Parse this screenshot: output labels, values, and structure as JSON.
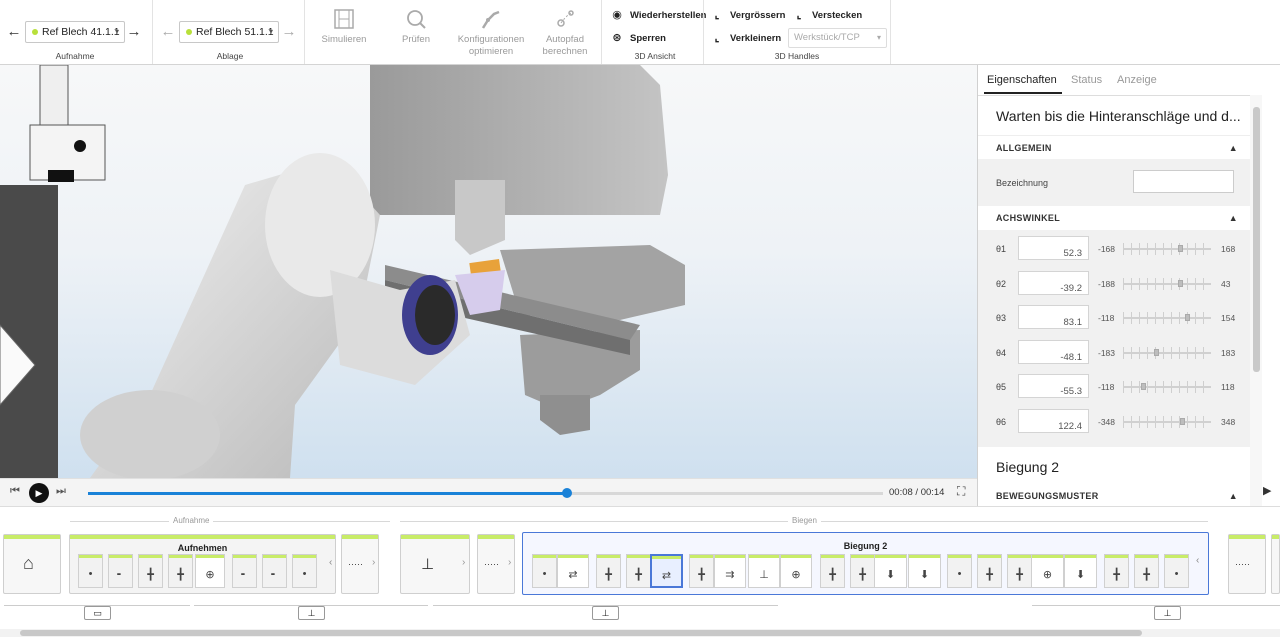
{
  "toolbar": {
    "aufnahme": {
      "value": "Ref Blech 41.1.1",
      "label": "Aufnahme"
    },
    "ablage": {
      "value": "Ref Blech 51.1.1",
      "label": "Ablage"
    },
    "simulieren": "Simulieren",
    "pruefen": "Prüfen",
    "konfig_1": "Konfigurationen",
    "konfig_2": "optimieren",
    "autopfad_1": "Autopfad",
    "autopfad_2": "berechnen",
    "wiederherstellen": "Wiederherstellen",
    "sperren": "Sperren",
    "ansicht_label": "3D Ansicht",
    "vergroessern": "Vergrössern",
    "verstecken": "Verstecken",
    "verkleinern": "Verkleinern",
    "handles_select": "Werkstück/TCP",
    "handles_label": "3D Handles"
  },
  "playback": {
    "time": "00:08 / 00:14",
    "progress": 0.602
  },
  "props": {
    "tabs": [
      "Eigenschaften",
      "Status",
      "Anzeige"
    ],
    "heading": "Warten bis die Hinteranschläge und d...",
    "allgemein": "ALLGEMEIN",
    "bezeichnung": "Bezeichnung",
    "achswinkel": "ACHSWINKEL",
    "axes": [
      {
        "label": "θ1",
        "value": "52.3",
        "min": "-168",
        "max": "168"
      },
      {
        "label": "θ2",
        "value": "-39.2",
        "min": "-188",
        "max": "43"
      },
      {
        "label": "θ3",
        "value": "83.1",
        "min": "-118",
        "max": "154"
      },
      {
        "label": "θ4",
        "value": "-48.1",
        "min": "-183",
        "max": "183"
      },
      {
        "label": "θ5",
        "value": "-55.3",
        "min": "-118",
        "max": "118"
      },
      {
        "label": "θ6",
        "value": "122.4",
        "min": "-348",
        "max": "348"
      }
    ],
    "heading2": "Biegung 2",
    "bewegungsmuster": "BEWEGUNGSMUSTER"
  },
  "timeline": {
    "section_aufnahme": "Aufnahme",
    "section_biegen": "Biegen",
    "card_aufnehmen": "Aufnehmen",
    "card_biegung2": "Biegung 2",
    "more": "·····"
  },
  "colors": {
    "accent": "#c8ec68",
    "selection": "#4a78d8",
    "progress": "#1a82d8"
  }
}
